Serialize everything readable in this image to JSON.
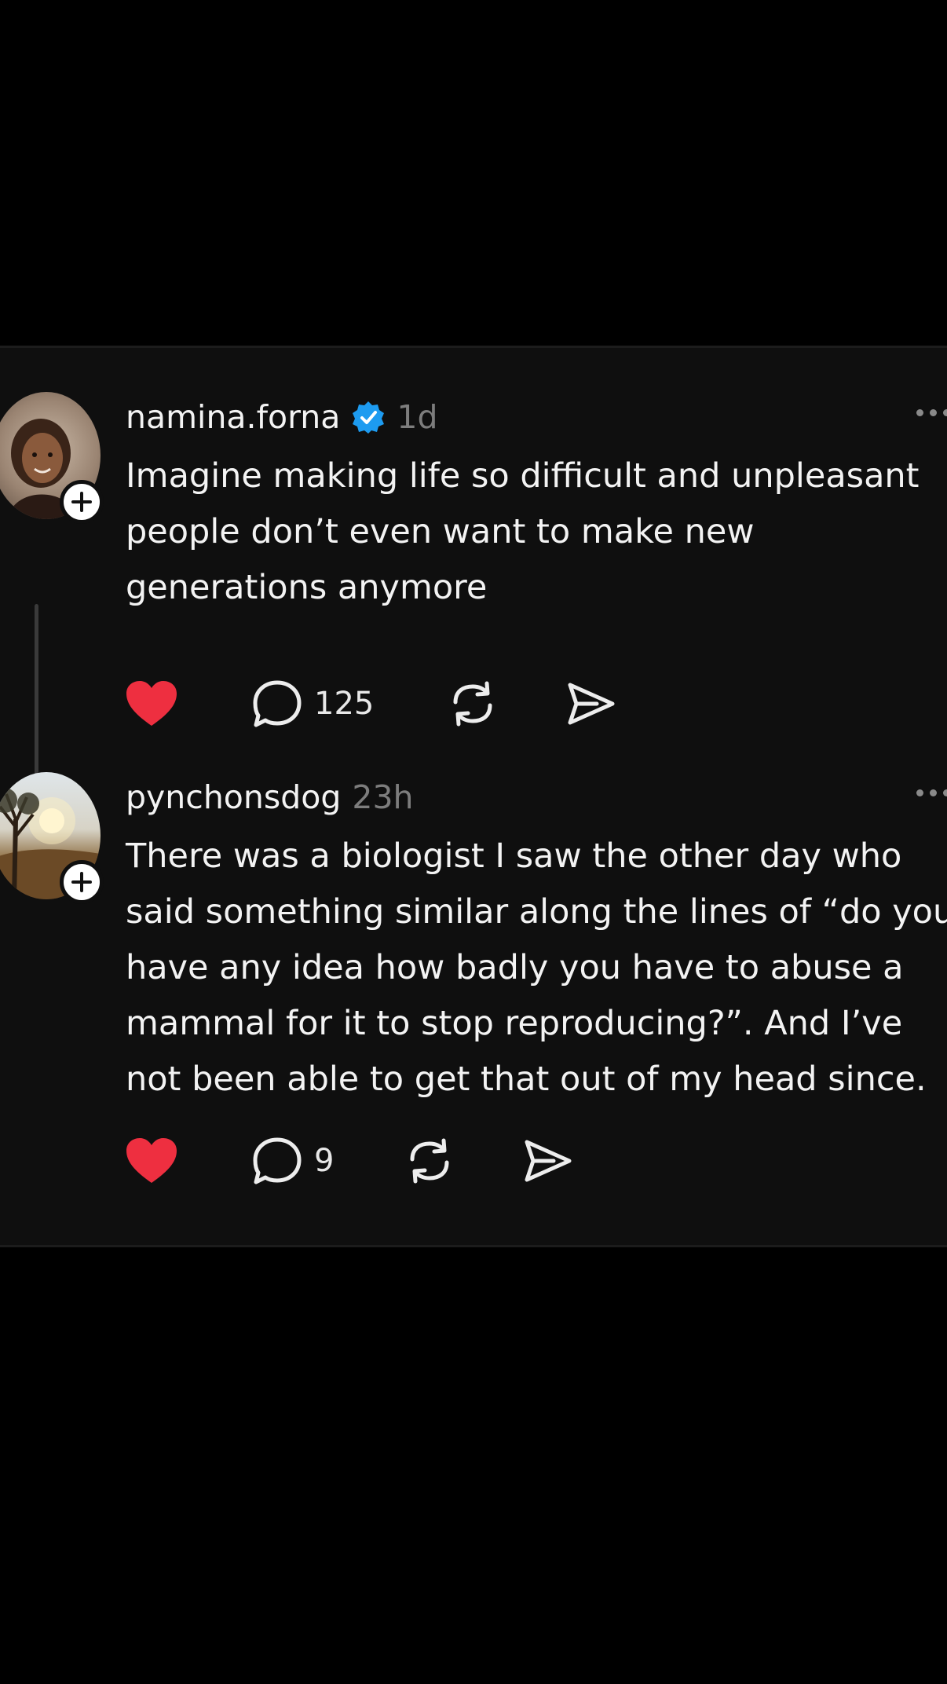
{
  "posts": [
    {
      "username": "namina.forna",
      "verified": true,
      "time": "1d",
      "text": "Imagine making life so difficult and unpleasant\npeople don’t even want to make new\ngenerations anymore",
      "liked": true,
      "replies": "125",
      "avatar_icon": "profile-photo-woman"
    },
    {
      "username": "pynchonsdog",
      "verified": false,
      "time": "23h",
      "text": "There was a biologist I saw the other day who\nsaid something similar along the lines of “do you\nhave any idea how badly you have to abuse a\nmammal for it to stop reproducing?”. And I’ve\nnot been able to get that out of my head since.",
      "liked": true,
      "replies": "9",
      "avatar_icon": "profile-photo-sunset-tree"
    }
  ],
  "colors": {
    "background": "#000000",
    "card": "#0f0f0f",
    "like_red": "#ee2f40",
    "verified_blue": "#1d9bf0",
    "muted_text": "#7d7d7d"
  }
}
